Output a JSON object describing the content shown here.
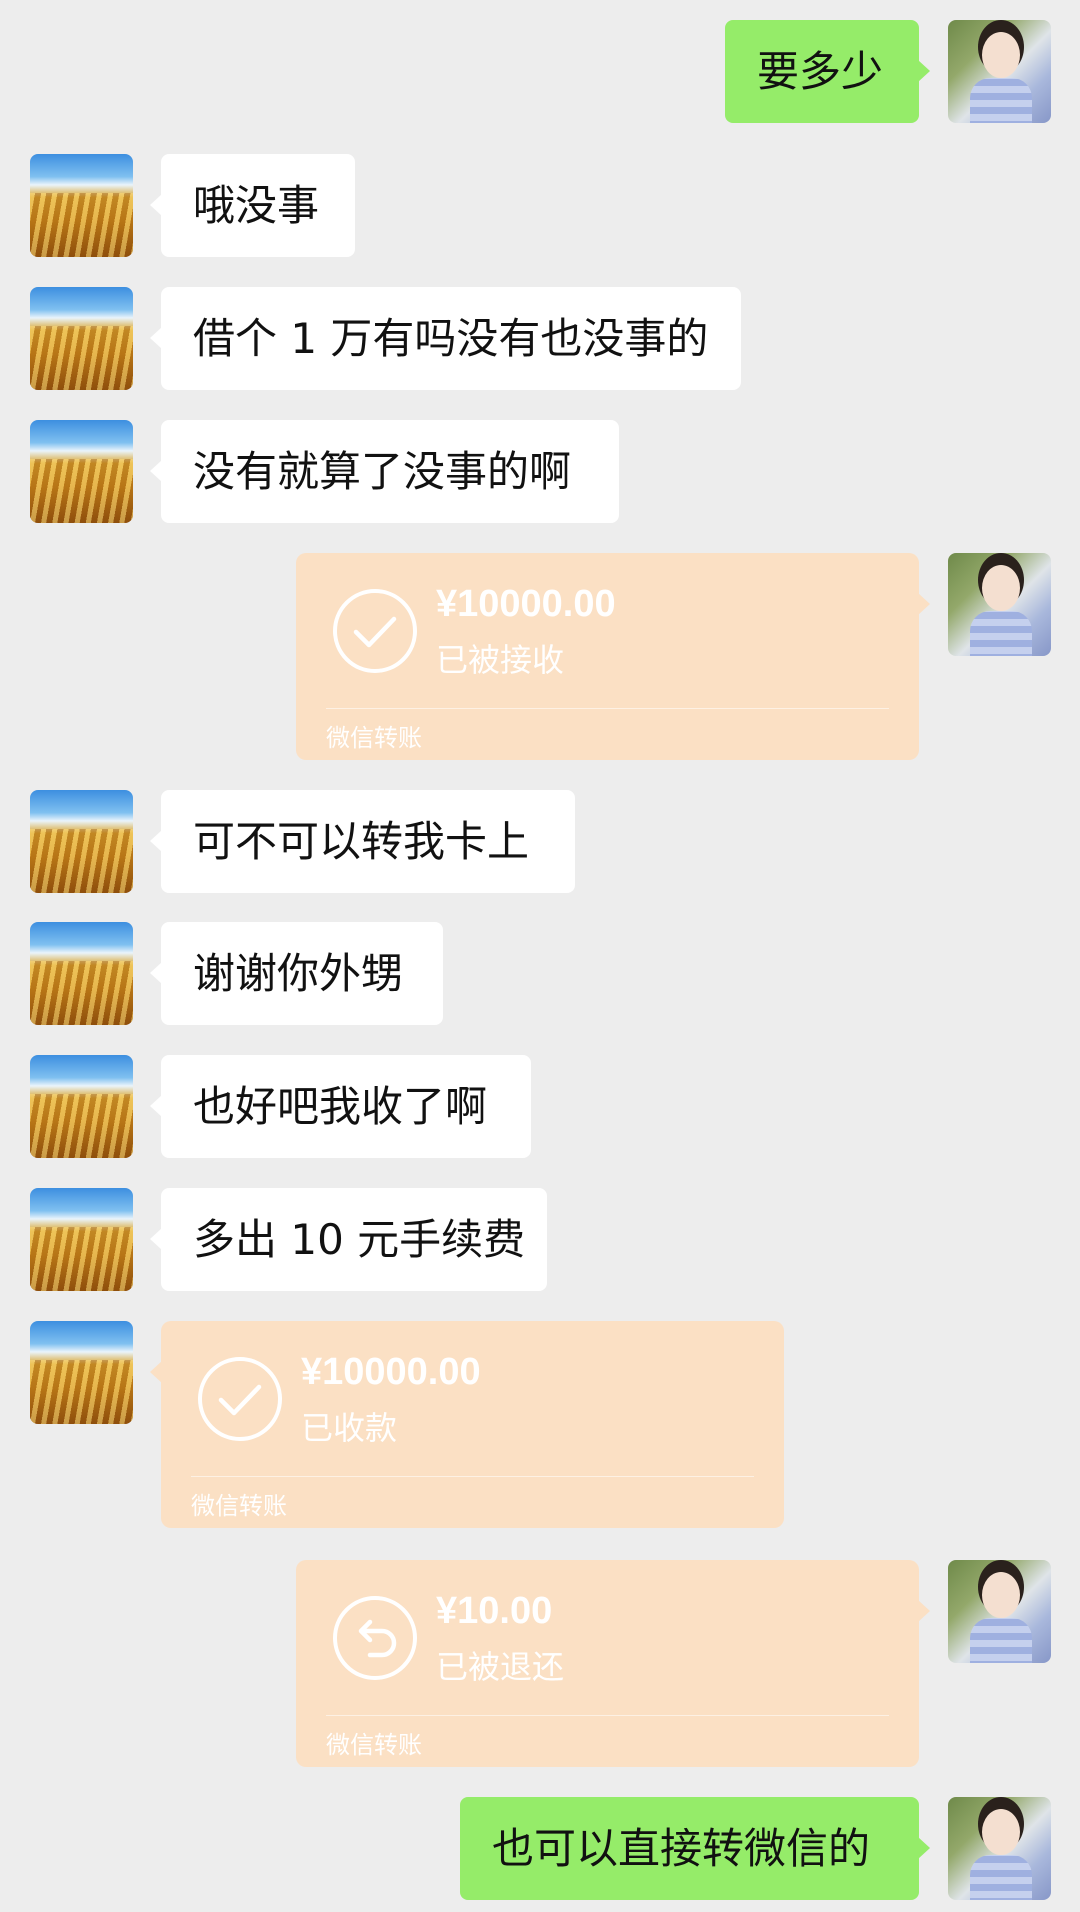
{
  "messages": [
    {
      "side": "right",
      "type": "text",
      "text": "要多少"
    },
    {
      "side": "left",
      "type": "text",
      "text": "哦没事"
    },
    {
      "side": "left",
      "type": "text",
      "text": "借个 1 万有吗没有也没事的"
    },
    {
      "side": "left",
      "type": "text",
      "text": "没有就算了没事的啊"
    },
    {
      "side": "right",
      "type": "transfer",
      "amount": "¥10000.00",
      "status": "已被接收",
      "label": "微信转账",
      "icon": "check-circle-icon"
    },
    {
      "side": "left",
      "type": "text",
      "text": "可不可以转我卡上"
    },
    {
      "side": "left",
      "type": "text",
      "text": "谢谢你外甥"
    },
    {
      "side": "left",
      "type": "text",
      "text": "也好吧我收了啊"
    },
    {
      "side": "left",
      "type": "text",
      "text": "多出 10 元手续费"
    },
    {
      "side": "left",
      "type": "transfer",
      "amount": "¥10000.00",
      "status": "已收款",
      "label": "微信转账",
      "icon": "check-circle-icon"
    },
    {
      "side": "right",
      "type": "transfer",
      "amount": "¥10.00",
      "status": "已被退还",
      "label": "微信转账",
      "icon": "return-circle-icon"
    },
    {
      "side": "right",
      "type": "text",
      "text": "也可以直接转微信的"
    }
  ],
  "avatars": {
    "left": "wheat-field-avatar",
    "right": "girl-avatar"
  },
  "colors": {
    "background": "#ededed",
    "bubble_left": "#ffffff",
    "bubble_right": "#95ec69",
    "transfer": "#fbe0c4"
  }
}
